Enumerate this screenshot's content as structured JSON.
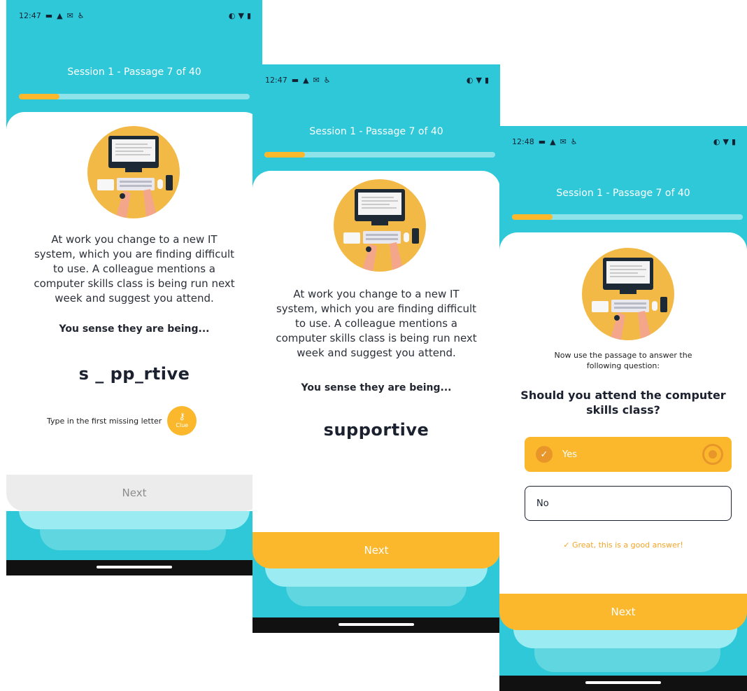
{
  "status_bar": {
    "screen1_time": "12:47",
    "screen2_time": "12:47",
    "screen3_time": "12:48",
    "left_icons": [
      "video-icon",
      "alert-icon",
      "mail-icon",
      "accessibility-icon"
    ],
    "right_icons": [
      "vibrate-icon",
      "wifi-icon",
      "battery-icon"
    ]
  },
  "session": {
    "title": "Session 1 - Passage 7 of 40",
    "progress_fraction": 0.175
  },
  "passage": {
    "lines": [
      "At work you change to a new IT",
      "system, which you are finding difficult",
      "to use.  A colleague mentions a",
      "computer skills class is being run next",
      "week and suggest you attend."
    ],
    "prompt": "You sense they are being..."
  },
  "screen1": {
    "word_partial": "s _ pp_rtive",
    "hint": "Type in the first missing letter",
    "clue_label": "Clue",
    "next_label": "Next"
  },
  "screen2": {
    "word_complete": "supportive",
    "next_label": "Next"
  },
  "screen3": {
    "intro_lines": [
      "Now use the passage to answer the",
      "following question:"
    ],
    "question_lines": [
      "Should you attend the computer",
      "skills class?"
    ],
    "options": [
      {
        "label": "Yes",
        "selected": true
      },
      {
        "label": "No",
        "selected": false
      }
    ],
    "feedback": "✓ Great, this is a good answer!",
    "next_label": "Next"
  },
  "colors": {
    "teal": "#2ec8d8",
    "accent": "#fbb82c",
    "progress_track": "#8ee3eb"
  }
}
